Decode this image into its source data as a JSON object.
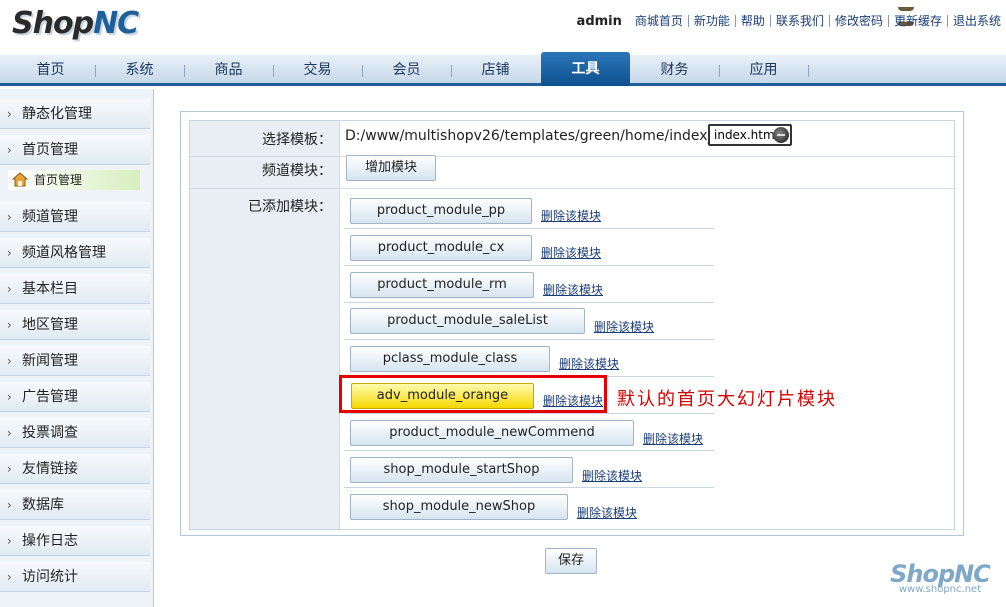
{
  "header": {
    "logo_left": "Shop",
    "logo_right": "NC",
    "username": "admin",
    "links": [
      "商城首页",
      "新功能",
      "帮助",
      "联系我们",
      "修改密码",
      "更新缓存",
      "退出系统"
    ]
  },
  "nav": {
    "tabs": [
      "首页",
      "系统",
      "商品",
      "交易",
      "会员",
      "店铺",
      "工具",
      "财务",
      "应用"
    ],
    "active": "工具"
  },
  "sidebar": {
    "items": [
      "静态化管理",
      "首页管理",
      "频道管理",
      "频道风格管理",
      "基本栏目",
      "地区管理",
      "新闻管理",
      "广告管理",
      "投票调查",
      "友情链接",
      "数据库",
      "操作日志",
      "访问统计"
    ],
    "sub_item": "首页管理",
    "arrow": "›"
  },
  "form": {
    "select_template_label": "选择模板：",
    "template_path": "D:/www/multishopv26/templates/green/home/index_tpl/",
    "template_value": "index.html",
    "channel_module_label": "频道模块：",
    "add_module_button": "增加模块",
    "added_modules_label": "已添加模块：",
    "delete_link": "删除该模块",
    "modules": [
      "product_module_pp",
      "product_module_cx",
      "product_module_rm",
      "product_module_saleList",
      "pclass_module_class",
      "adv_module_orange",
      "product_module_newCommend",
      "shop_module_startShop",
      "shop_module_newShop"
    ],
    "save_button": "保存"
  },
  "annotation": {
    "text": "默认的首页大幻灯片模块",
    "color": "#d40000"
  },
  "watermark": {
    "logo": "ShopNC",
    "url": "www.shopnc.net"
  },
  "colors": {
    "accent": "#1f5f9a",
    "highlight_module": "#f5d800"
  }
}
